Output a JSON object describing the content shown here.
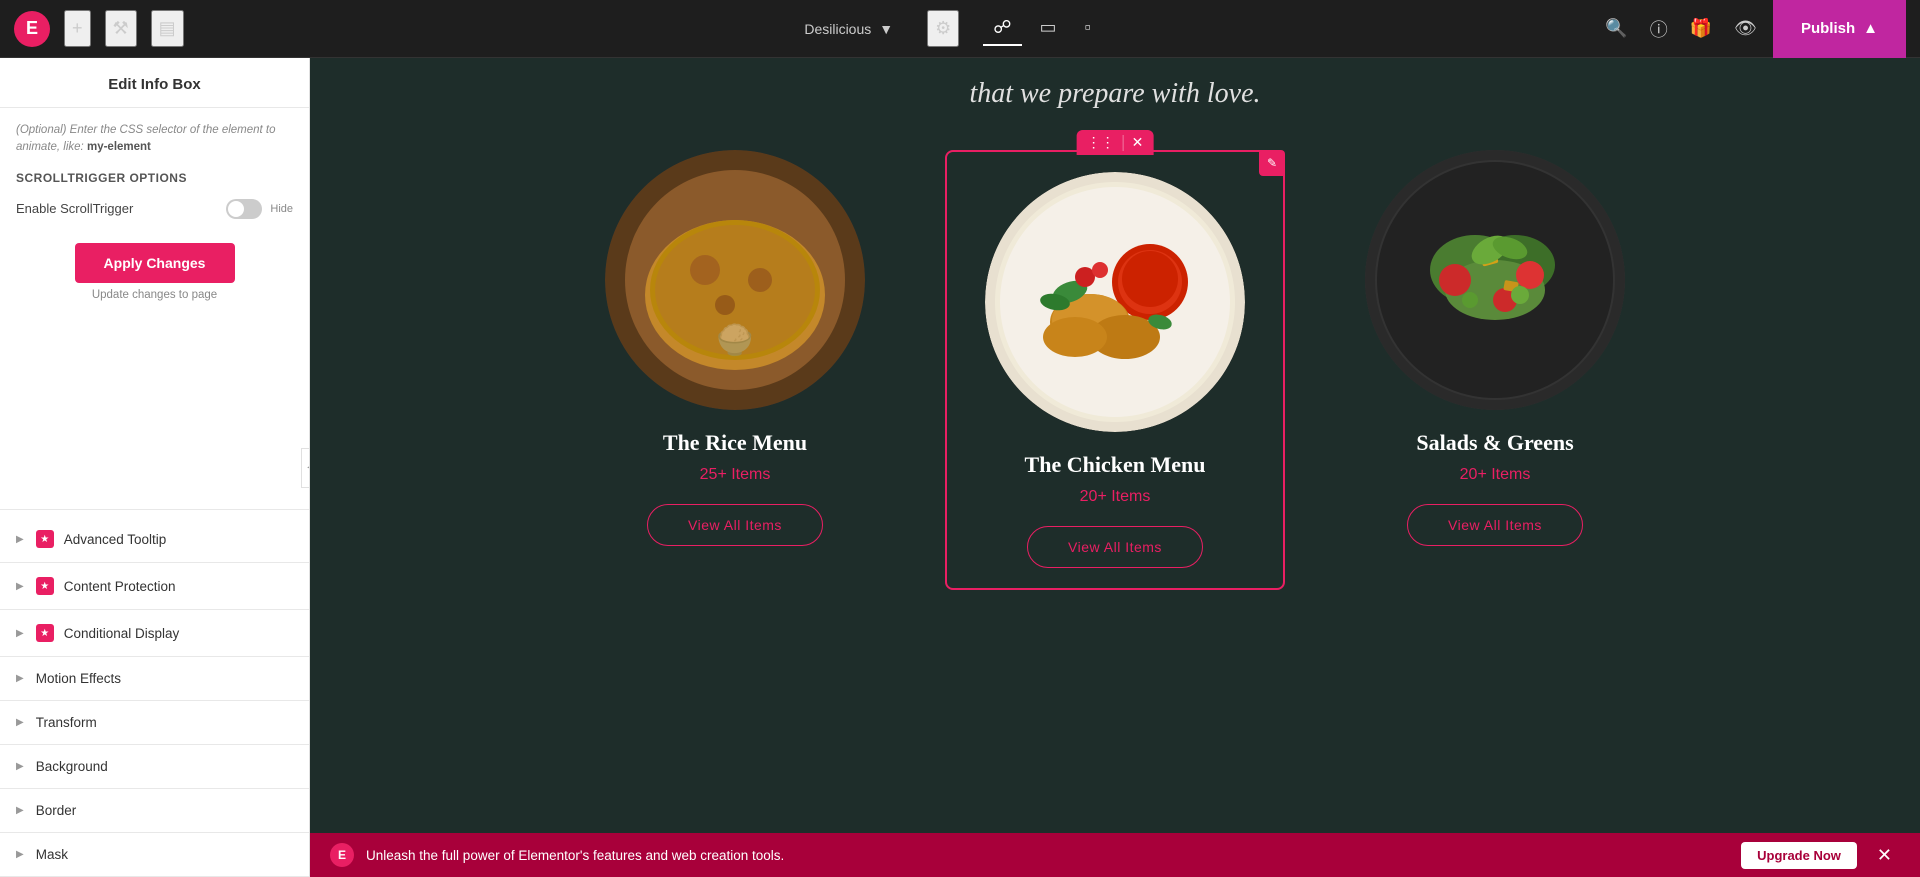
{
  "topbar": {
    "logo_letter": "E",
    "site_name": "Desilicious",
    "device_icons": [
      "desktop",
      "tablet",
      "mobile"
    ],
    "active_device": "desktop",
    "publish_label": "Publish"
  },
  "left_panel": {
    "title": "Edit Info Box",
    "optional_hint": "(Optional) Enter the CSS selector of the element to animate, like:",
    "hint_code": "my-element",
    "scrolltrigger_section": "ScrollTrigger Options",
    "scrolltrigger_label": "Enable ScrollTrigger",
    "toggle_hide_label": "Hide",
    "apply_button": "Apply Changes",
    "update_text": "Update changes to page",
    "accordion_items": [
      {
        "id": "advanced-tooltip",
        "label": "Advanced Tooltip",
        "has_icon": true,
        "icon_label": "★"
      },
      {
        "id": "content-protection",
        "label": "Content Protection",
        "has_icon": true,
        "icon_label": "★"
      },
      {
        "id": "conditional-display",
        "label": "Conditional Display",
        "has_icon": true,
        "icon_label": "★"
      },
      {
        "id": "motion-effects",
        "label": "Motion Effects",
        "has_icon": false,
        "icon_label": ""
      },
      {
        "id": "transform",
        "label": "Transform",
        "has_icon": false,
        "icon_label": ""
      },
      {
        "id": "background",
        "label": "Background",
        "has_icon": false,
        "icon_label": ""
      },
      {
        "id": "border",
        "label": "Border",
        "has_icon": false,
        "icon_label": ""
      },
      {
        "id": "mask",
        "label": "Mask",
        "has_icon": false,
        "icon_label": ""
      }
    ]
  },
  "canvas": {
    "subtitle": "that we prepare with love.",
    "food_cards": [
      {
        "id": "rice-menu",
        "name": "The Rice Menu",
        "count": "25+ Items",
        "button": "View All Items",
        "selected": false
      },
      {
        "id": "chicken-menu",
        "name": "The Chicken Menu",
        "count": "20+ Items",
        "button": "View All Items",
        "selected": true
      },
      {
        "id": "salads-greens",
        "name": "Salads & Greens",
        "count": "20+ Items",
        "button": "View All Items",
        "selected": false
      }
    ]
  },
  "notification": {
    "text": "Unleash the full power of Elementor's features and web creation tools.",
    "upgrade_label": "Upgrade Now"
  }
}
